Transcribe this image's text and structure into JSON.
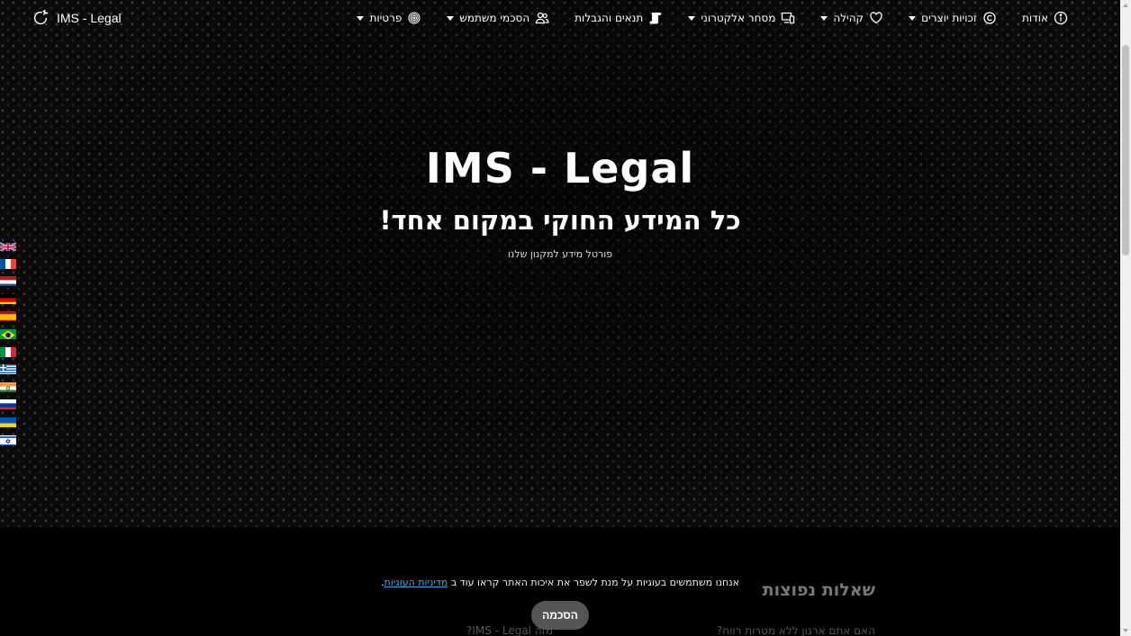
{
  "brand": {
    "name": "IMS - Legal"
  },
  "nav": {
    "items": [
      {
        "label": "אודות",
        "icon": "info-icon",
        "dropdown": false
      },
      {
        "label": "זכויות יוצרים",
        "icon": "copyright-icon",
        "dropdown": true
      },
      {
        "label": "קהילה",
        "icon": "heart-icon",
        "dropdown": true
      },
      {
        "label": "מסחר אלקטרוני",
        "icon": "devices-icon",
        "dropdown": true
      },
      {
        "label": "תנאים והגבלות",
        "icon": "scroll-icon",
        "dropdown": false
      },
      {
        "label": "הסכמי משתמש",
        "icon": "users-icon",
        "dropdown": true
      },
      {
        "label": "פרטיות",
        "icon": "fingerprint-icon",
        "dropdown": true
      }
    ]
  },
  "hero": {
    "title": "IMS - Legal",
    "subtitle": "כל המידע החוקי במקום אחד!",
    "tagline": "פורטל מידע למקנון שלנו"
  },
  "languages": [
    "English",
    "Français",
    "Nederlands",
    "Deutsch",
    "Español",
    "Português (Brasil)",
    "Italiano",
    "Ελληνικά",
    "हिन्दी",
    "Русский",
    "Українська",
    "עברית"
  ],
  "faq": {
    "title": "שאלות נפוצות",
    "q1": "האם אתם ארגון ללא מטרות רווח?",
    "q2": "מזה IMS - Legal?"
  },
  "cookie": {
    "text": "אנחנו משתמשים בעוגיות על מנת לשפר את איכות האתר קראו עוד ב",
    "link": "מדיניות העוגיות",
    "end": ".",
    "accept": "הסכמה"
  }
}
